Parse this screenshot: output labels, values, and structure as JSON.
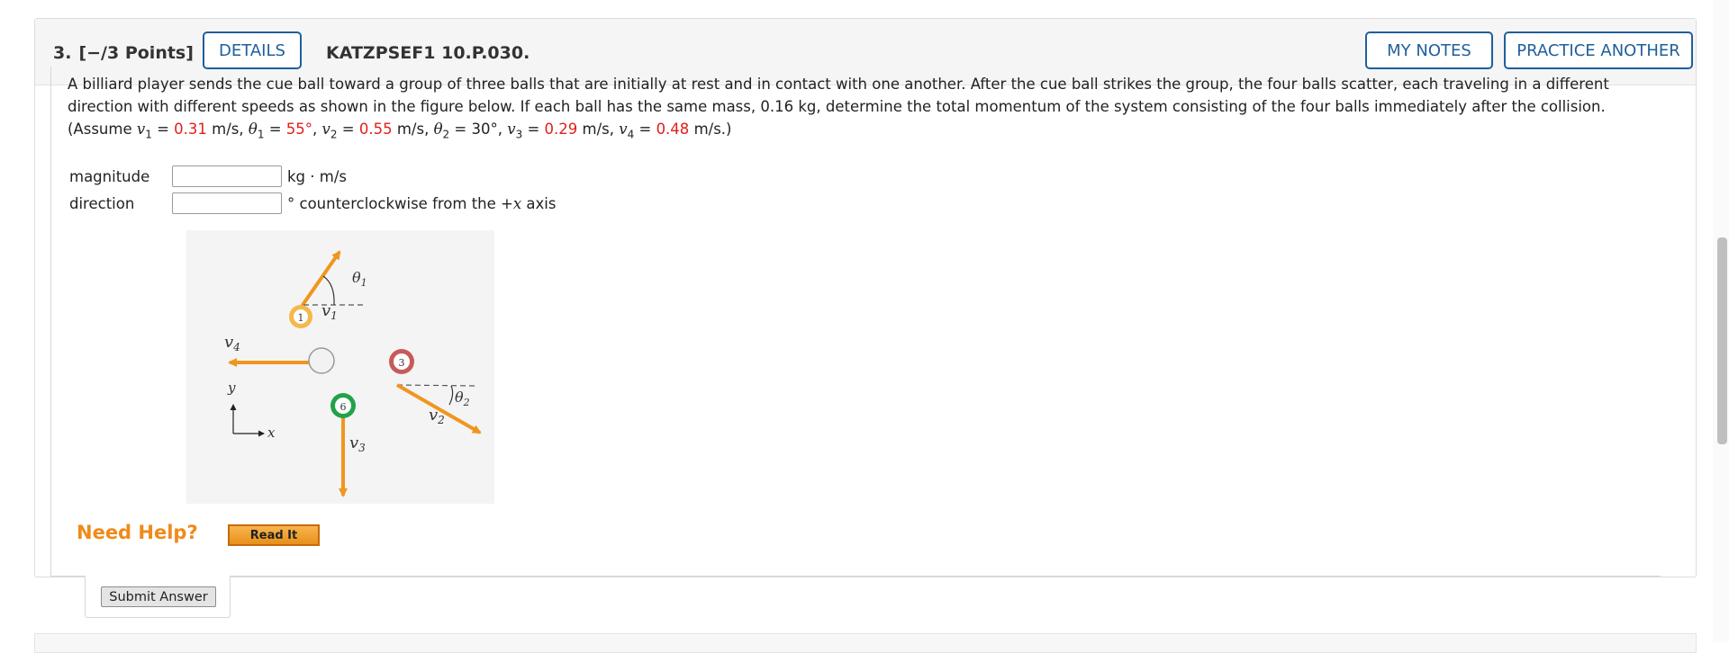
{
  "question": {
    "number": "3.",
    "points": "[−/3 Points]",
    "details_label": "DETAILS",
    "code": "KATZPSEF1 10.P.030.",
    "my_notes_label": "MY NOTES",
    "practice_label": "PRACTICE ANOTHER"
  },
  "problem": {
    "text_main": "A billiard player sends the cue ball toward a group of three balls that are initially at rest and in contact with one another. After the cue ball strikes the group, the four balls scatter, each traveling in a different direction with different speeds as shown in the figure below. If each ball has the same mass, 0.16 kg, determine the total momentum of the system consisting of the four balls immediately after the collision.",
    "assume_prefix": "(Assume ",
    "v1_sym": "v",
    "v1_sub": "1",
    "v1_val": "0.31",
    "theta1_sym": "θ",
    "theta1_sub": "1",
    "theta1_val": "55°",
    "v2_sym": "v",
    "v2_sub": "2",
    "v2_val": "0.55",
    "theta2_sym": "θ",
    "theta2_sub": "2",
    "theta2_val": "30°",
    "v3_sym": "v",
    "v3_sub": "3",
    "v3_val": "0.29",
    "v4_sym": "v",
    "v4_sub": "4",
    "v4_val": "0.48",
    "unit_ms": "m/s",
    "unit_deg_comma": ",",
    "closing": "m/s.)"
  },
  "answers": {
    "magnitude_label": "magnitude",
    "magnitude_value": "",
    "magnitude_unit": "kg · m/s",
    "direction_label": "direction",
    "direction_value": "",
    "direction_unit_prefix": "° counterclockwise from the +",
    "direction_unit_var": "x",
    "direction_unit_suffix": " axis"
  },
  "figure": {
    "v1": "v",
    "v1_sub": "1",
    "theta1": "θ",
    "theta1_sub": "1",
    "v2": "v",
    "v2_sub": "2",
    "theta2": "θ",
    "theta2_sub": "2",
    "v3": "v",
    "v3_sub": "3",
    "v4": "v",
    "v4_sub": "4",
    "ball1": "1",
    "ball3": "3",
    "ball6": "6",
    "y_axis": "y",
    "x_axis": "x",
    "arrow_color": "#f0961e",
    "ball1_color": "#f5b84a",
    "ball3_color": "#c85a5a",
    "ball6_color": "#22a24a"
  },
  "help": {
    "need_help": "Need Help?",
    "read_it": "Read It"
  },
  "submit_label": "Submit Answer"
}
